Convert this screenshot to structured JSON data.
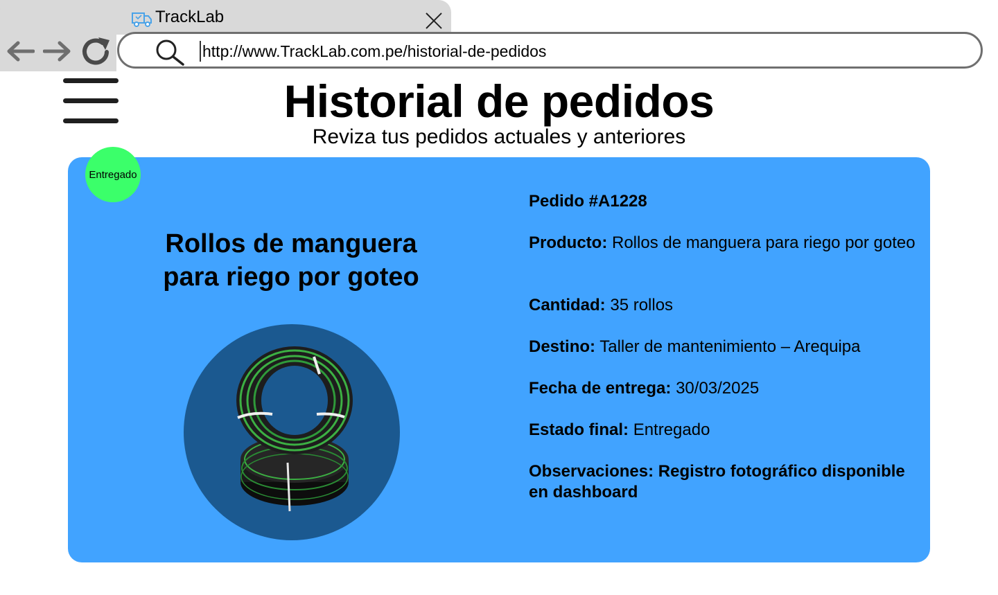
{
  "browser": {
    "tab_title": "TrackLab",
    "url": "http://www.TrackLab.com.pe/historial-de-pedidos",
    "tab_icon": "delivery-truck-icon"
  },
  "header": {
    "title": "Historial de pedidos",
    "subtitle": "Reviza tus pedidos actuales y anteriores"
  },
  "order_card": {
    "status_badge": "Entregado",
    "product_title": "Rollos de manguera para riego por goteo",
    "product_image": "black-and-green-drip-irrigation-hose-rolls",
    "order_id": "Pedido #A1228",
    "fields": [
      {
        "label": "Producto:",
        "value": "Rollos de manguera para riego por goteo"
      },
      {
        "label": "Cantidad:",
        "value": "35 rollos"
      },
      {
        "label": "Destino:",
        "value": "Taller de mantenimiento – Arequipa"
      },
      {
        "label": "Fecha de entrega:",
        "value": "30/03/2025"
      },
      {
        "label": "Estado final:",
        "value": "Entregado"
      },
      {
        "label": "Observaciones:",
        "value": "Registro fotográfico disponible en dashboard"
      }
    ]
  },
  "colors": {
    "card_background": "#41a3ff",
    "badge_background": "#3bff6a",
    "image_circle": "#1b5990",
    "browser_chrome": "#d9d9d9"
  }
}
